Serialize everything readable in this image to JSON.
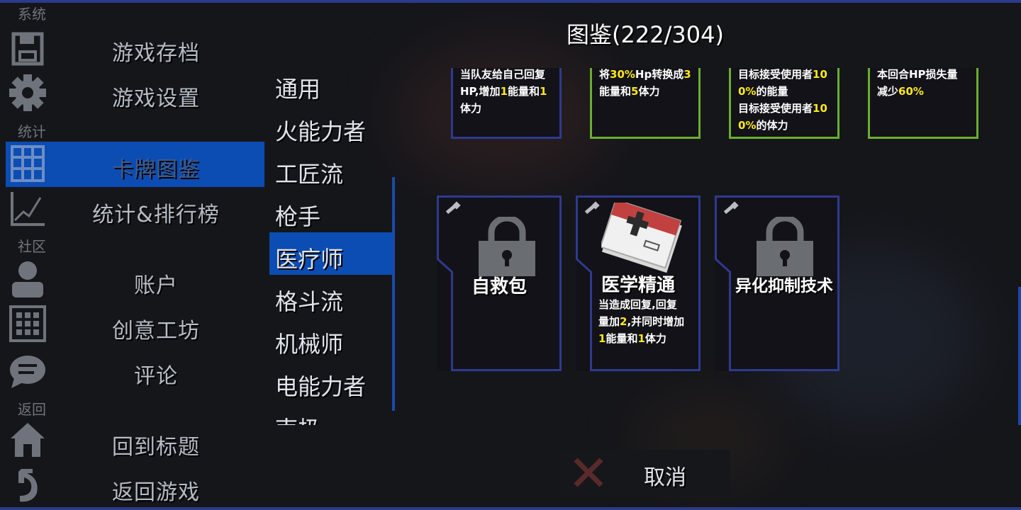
{
  "title": "图鉴(222/304)",
  "sections": {
    "system": "系统",
    "stats": "统计",
    "community": "社区",
    "back": "返回"
  },
  "menu": {
    "save": "游戏存档",
    "settings": "游戏设置",
    "cards": "卡牌图鉴",
    "leaderboard": "统计&排行榜",
    "account": "账户",
    "workshop": "创意工坊",
    "comments": "评论",
    "title_screen": "回到标题",
    "resume": "返回游戏"
  },
  "categories": [
    "通用",
    "火能力者",
    "工匠流",
    "枪手",
    "医疗师",
    "格斗流",
    "机械师",
    "电能力者",
    "南极"
  ],
  "selected_category": "医疗师",
  "top_cards": [
    {
      "lines": [
        [
          "当队友给自己回复",
          ""
        ],
        [
          "HP,增加",
          "1",
          "能量和",
          "1"
        ],
        [
          "体力"
        ]
      ]
    },
    {
      "lines": [
        [
          "将",
          "30%",
          "Hp转换成",
          "3"
        ],
        [
          "能量和",
          "5",
          "体力"
        ]
      ]
    },
    {
      "lines": [
        [
          "目标接受使用者",
          "10"
        ],
        [
          "0%",
          "的能量"
        ],
        [
          "目标接受使用者",
          "10"
        ],
        [
          "0%",
          "的体力"
        ]
      ]
    },
    {
      "lines": [
        [
          "本回合HP损失量"
        ],
        [
          "减少",
          "60%"
        ]
      ]
    }
  ],
  "cards": [
    {
      "name": "自救包",
      "locked": true
    },
    {
      "name": "医学精通",
      "locked": false,
      "desc": [
        [
          "当造成回复,回复"
        ],
        [
          "量加",
          "2",
          ",并同时增加"
        ],
        [
          "1",
          "能量和",
          "1",
          "体力"
        ]
      ]
    },
    {
      "name": "异化抑制技术",
      "locked": true
    }
  ],
  "cancel_label": "取消",
  "colors": {
    "accent": "#0b4db3",
    "highlight": "#ffe81a",
    "border_blue": "#2a3b8a",
    "border_green": "#6aae2e"
  }
}
